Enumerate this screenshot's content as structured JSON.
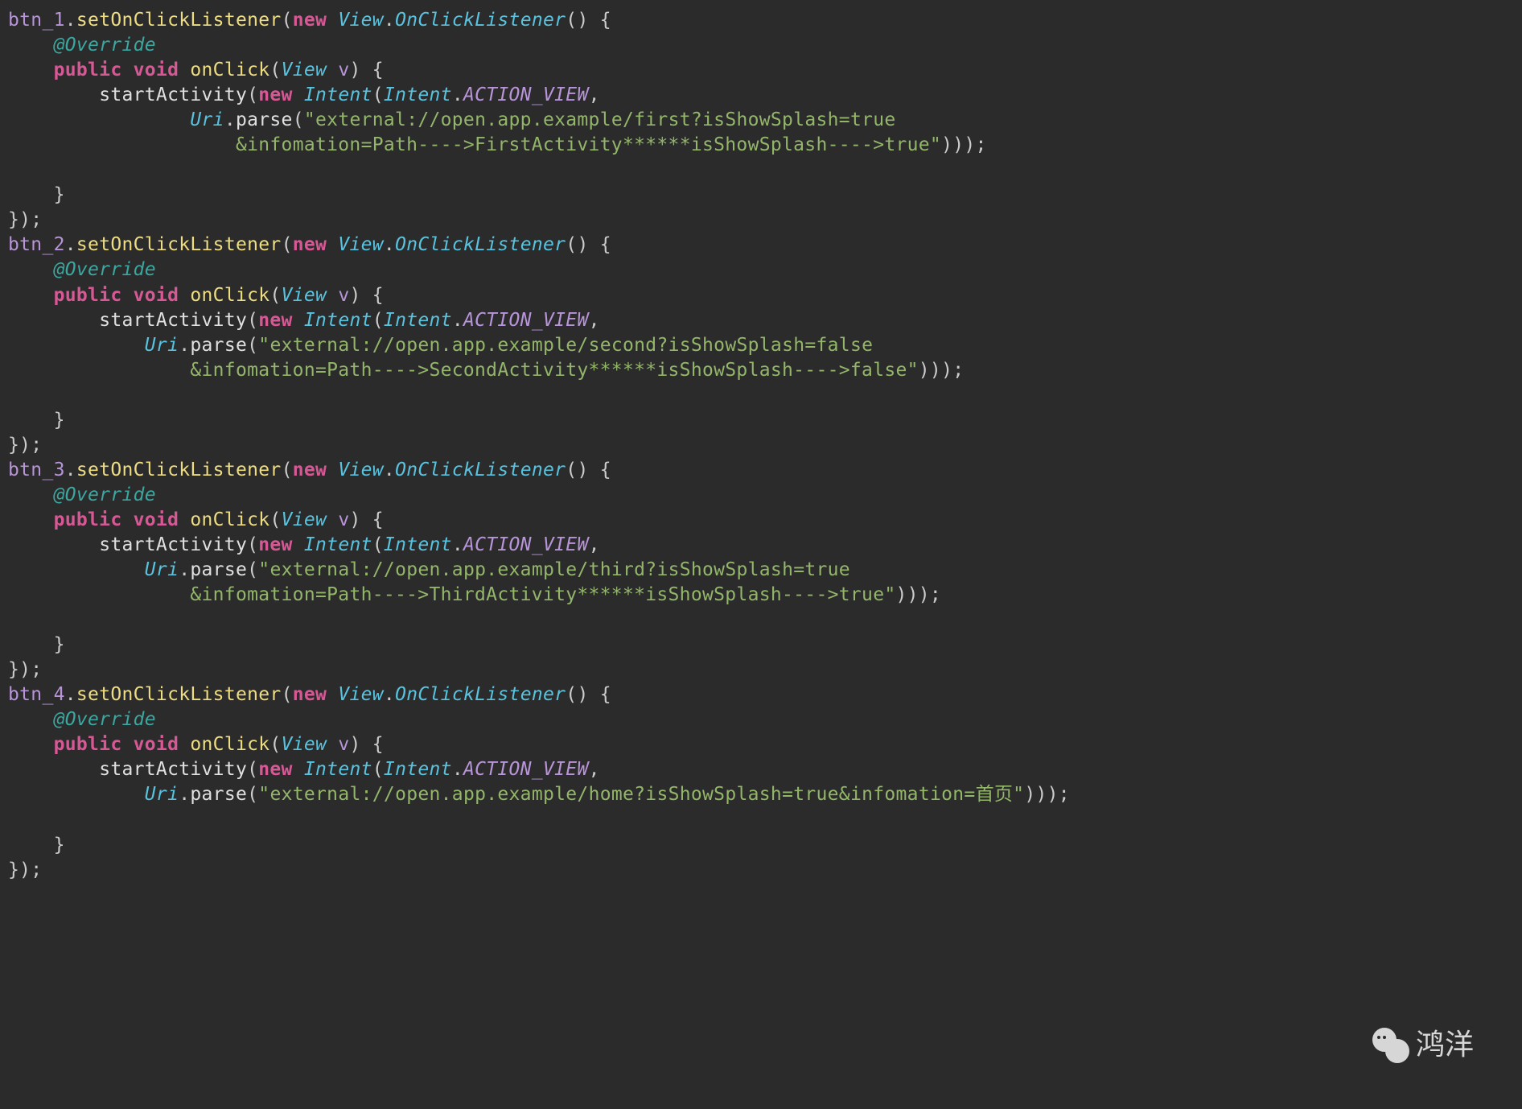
{
  "watermark": {
    "label": "鸿洋"
  },
  "tokens": {
    "new": "new",
    "public": "public",
    "void": "void",
    "override": "@Override",
    "View": "View",
    "OnClickListener": "OnClickListener",
    "onClick": "onClick",
    "v": "v",
    "Intent": "Intent",
    "ACTION_VIEW": "ACTION_VIEW",
    "Uri": "Uri",
    "parse": "parse",
    "setOnClickListener": "setOnClickListener",
    "startActivity": "startActivity"
  },
  "blocks": [
    {
      "btn": "btn_1",
      "str1": "\"external://open.app.example/first?isShowSplash=true",
      "str2": "&infomation=Path---->FirstActivity******isShowSplash---->true\"",
      "multiline": true
    },
    {
      "btn": "btn_2",
      "str1": "\"external://open.app.example/second?isShowSplash=false",
      "str2": "&infomation=Path---->SecondActivity******isShowSplash---->false\"",
      "multiline": true
    },
    {
      "btn": "btn_3",
      "str1": "\"external://open.app.example/third?isShowSplash=true",
      "str2": "&infomation=Path---->ThirdActivity******isShowSplash---->true\"",
      "multiline": true
    },
    {
      "btn": "btn_4",
      "str1": "\"external://open.app.example/home?isShowSplash=true&infomation=首页\"",
      "multiline": false
    }
  ]
}
